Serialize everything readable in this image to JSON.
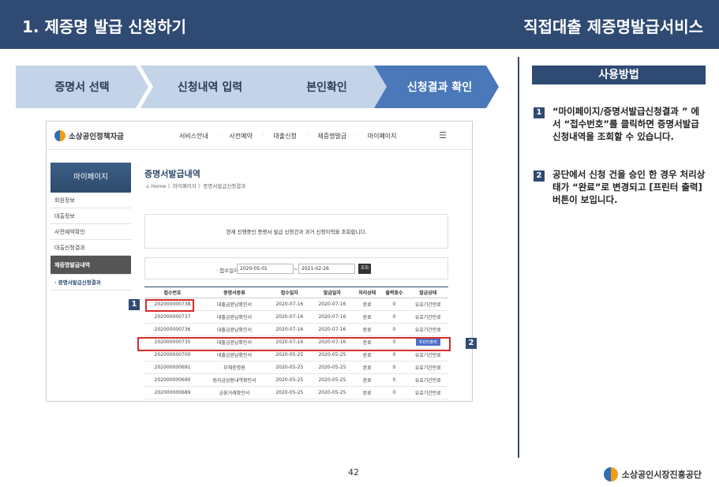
{
  "header": {
    "title": "1. 제증명 발급 신청하기",
    "service": "직접대출 제증명발급서비스"
  },
  "steps": [
    "증명서 선택",
    "신청내역 입력",
    "본인확인",
    "신청결과 확인"
  ],
  "howto": {
    "heading": "사용방법",
    "items": [
      {
        "num": "1",
        "text": "“마이페이지/증명서발급신청결과 ” 에서 “접수번호”를 클릭하면 증명서발급신청내역을 조회할 수 있습니다."
      },
      {
        "num": "2",
        "text": "공단에서 신청 건을 승인 한 경우 처리상태가 “완료”로 변경되고 [프린터 출력] 버튼이 보입니다."
      }
    ]
  },
  "screenshot": {
    "logo": "소상공인정책자금",
    "menu": [
      "서비스안내",
      "사전예약",
      "대출신청",
      "제증명발급",
      "마이페이지"
    ],
    "sidebar": {
      "heading": "마이페이지",
      "items": [
        "회원정보",
        "대출정보",
        "사전예약확인",
        "대출신청결과",
        "제증명발급내역",
        "· 증명서발급신청결과"
      ]
    },
    "page_title": "증명서발급내역",
    "breadcrumb": "Home 〉마이페이지 〉증명서발급신청결과",
    "notice": "현재 진행중인 증명서 발급 신청건과 과거 신청이력을 조회합니다.",
    "search": {
      "label": "· 접수일자",
      "from": "2020-05-01",
      "to": "2021-02-26",
      "button": "조회"
    },
    "table": {
      "headers": [
        "접수번호",
        "증명서종류",
        "접수일자",
        "발급일자",
        "처리상태",
        "출력횟수",
        "발급상태"
      ],
      "rows": [
        [
          "202000000738",
          "대출금완납확인서",
          "2020-07-16",
          "2020-07-16",
          "완료",
          "0",
          "유효기간만료"
        ],
        [
          "202000000737",
          "대출금완납확인서",
          "2020-07-16",
          "2020-07-16",
          "완료",
          "0",
          "유효기간만료"
        ],
        [
          "202000000736",
          "대출금완납확인서",
          "2020-07-16",
          "2020-07-16",
          "완료",
          "0",
          "유효기간만료"
        ],
        [
          "202000000735",
          "대출금완납확인서",
          "2020-07-16",
          "2020-07-16",
          "완료",
          "0",
          "프린터출력"
        ],
        [
          "202000000700",
          "대출금완납확인서",
          "2020-05-25",
          "2020-05-25",
          "완료",
          "0",
          "유효기간만료"
        ],
        [
          "202000000691",
          "부채증명원",
          "2020-05-25",
          "2020-05-25",
          "완료",
          "0",
          "유효기간만료"
        ],
        [
          "202000000690",
          "원리금상환내역확인서",
          "2020-05-25",
          "2020-05-25",
          "완료",
          "0",
          "유효기간만료"
        ],
        [
          "202000000689",
          "금융거래확인서",
          "2020-05-25",
          "2020-05-25",
          "완료",
          "0",
          "유효기간만료"
        ]
      ]
    }
  },
  "markers": [
    "1",
    "2"
  ],
  "page_number": "42",
  "footer_org": "소상공인시장진흥공단"
}
